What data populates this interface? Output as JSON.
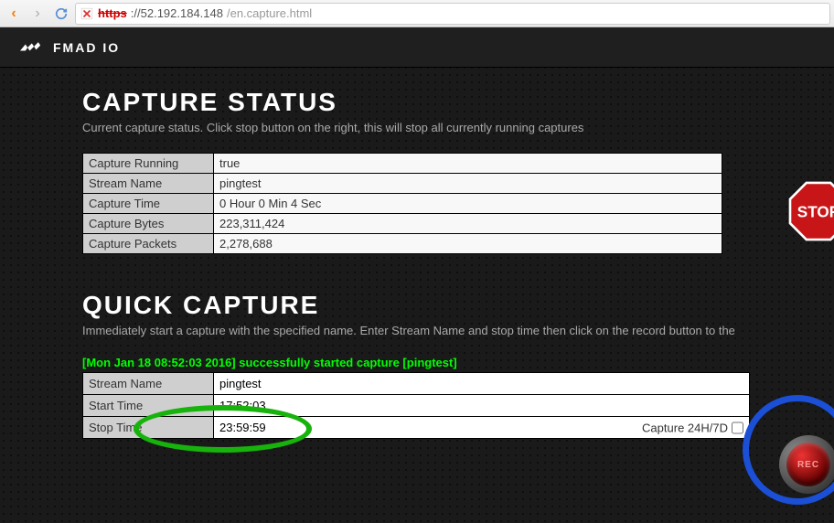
{
  "browser": {
    "url_scheme": "https",
    "url_host": "://52.192.184.148",
    "url_path": "/en.capture.html"
  },
  "brand": "FMAD IO",
  "section1": {
    "title": "CAPTURE STATUS",
    "subtitle": "Current capture status. Click stop button on the right, this will stop all currently running captures",
    "rows": [
      {
        "label": "Capture Running",
        "value": "true"
      },
      {
        "label": "Stream Name",
        "value": "pingtest"
      },
      {
        "label": "Capture Time",
        "value": "0 Hour 0 Min 4 Sec"
      },
      {
        "label": "Capture Bytes",
        "value": "223,311,424"
      },
      {
        "label": "Capture Packets",
        "value": "2,278,688"
      }
    ],
    "stop_label": "STOP"
  },
  "section2": {
    "title": "QUICK CAPTURE",
    "subtitle": "Immediately start a capture with the specified name. Enter Stream Name and stop time then click on the record button to the ",
    "status_line": "[Mon Jan 18 08:52:03 2016] successfully started capture [pingtest]",
    "rows": [
      {
        "label": "Stream Name",
        "value": "pingtest"
      },
      {
        "label": "Start Time",
        "value": "17:52:03"
      },
      {
        "label": "Stop Time",
        "value": "23:59:59"
      }
    ],
    "capture247_label": "Capture 24H/7D",
    "rec_label": "REC"
  }
}
